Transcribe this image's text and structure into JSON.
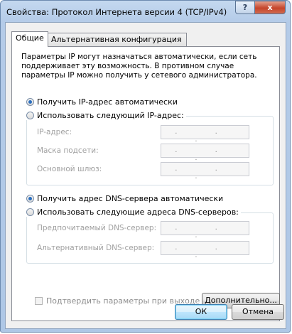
{
  "window": {
    "title": "Свойства: Протокол Интернета версии 4 (TCP/IPv4)",
    "help_glyph": "?",
    "close_glyph": "x"
  },
  "tabs": [
    {
      "label": "Общие",
      "active": true
    },
    {
      "label": "Альтернативная конфигурация",
      "active": false
    }
  ],
  "general": {
    "description": "Параметры IP могут назначаться автоматически, если сеть поддерживает эту возможность. В противном случае параметры IP можно получить у сетевого администратора.",
    "ip_auto": {
      "label": "Получить IP-адрес автоматически",
      "checked": true
    },
    "ip_manual": {
      "label": "Использовать следующий IP-адрес:",
      "checked": false
    },
    "ip_fields": [
      {
        "label": "IP-адрес:",
        "value": ". . ."
      },
      {
        "label": "Маска подсети:",
        "value": ". . ."
      },
      {
        "label": "Основной шлюз:",
        "value": ". . ."
      }
    ],
    "dns_auto": {
      "label": "Получить адрес DNS-сервера автоматически",
      "checked": true
    },
    "dns_manual": {
      "label": "Использовать следующие адреса DNS-серверов:",
      "checked": false
    },
    "dns_fields": [
      {
        "label": "Предпочитаемый DNS-сервер:",
        "value": ". . ."
      },
      {
        "label": "Альтернативный DNS-сервер:",
        "value": ". . ."
      }
    ],
    "validate": {
      "label": "Подтвердить параметры при выходе",
      "checked": false,
      "enabled": false
    },
    "advanced_label": "Дополнительно..."
  },
  "buttons": {
    "ok": "ОК",
    "cancel": "Отмена"
  },
  "colors": {
    "frame": "#b4cbe8",
    "close": "#c5452b",
    "radio_dot": "#2a6ebf",
    "ok_focus": "#3c7fb1"
  }
}
